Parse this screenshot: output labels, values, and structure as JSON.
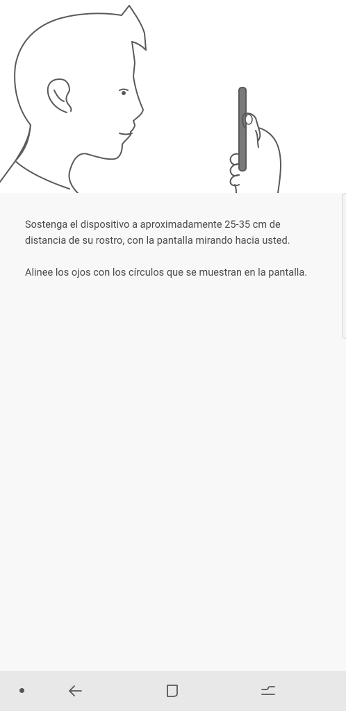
{
  "instructions": {
    "hold_device": "Sostenga el dispositivo a aproximadamente 25-35 cm de distancia de su rostro, con la pantalla mirando hacia usted.",
    "align_eyes": "Alinee los ojos con los círculos que se muestran en la pantalla."
  },
  "illustration": {
    "icon": "person-holding-phone-illustration"
  },
  "navigation_bar": {
    "buttons": [
      "dot-indicator",
      "back-icon",
      "home-icon",
      "recent-apps-icon"
    ]
  },
  "colors": {
    "illustration_background": "#ffffff",
    "content_background": "#f8f8f8",
    "navbar_background": "#e8e8e8",
    "line_art": "#5a5a5a",
    "text": "#4a4a4a"
  }
}
